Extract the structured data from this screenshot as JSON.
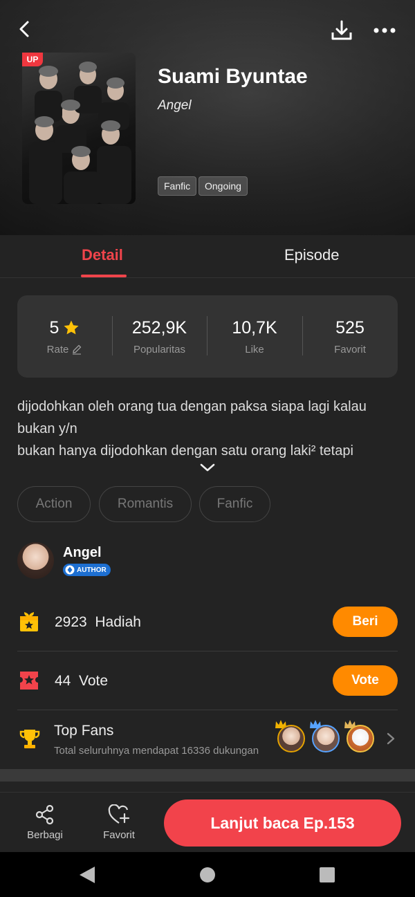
{
  "header": {
    "title": "Suami Byuntae",
    "author": "Angel",
    "up_badge": "UP",
    "chips": [
      "Fanfic",
      "Ongoing"
    ]
  },
  "tabs": [
    {
      "label": "Detail",
      "active": true
    },
    {
      "label": "Episode",
      "active": false
    }
  ],
  "stats": [
    {
      "value": "5",
      "label": "Rate"
    },
    {
      "value": "252,9K",
      "label": "Popularitas"
    },
    {
      "value": "10,7K",
      "label": "Like"
    },
    {
      "value": "525",
      "label": "Favorit"
    }
  ],
  "synopsis": [
    "dijodohkan oleh orang tua dengan paksa siapa lagi kalau",
    "bukan y/n",
    "bukan hanya dijodohkan dengan satu orang laki² tetapi"
  ],
  "genres": [
    "Action",
    "Romantis",
    "Fanfic"
  ],
  "author_section": {
    "name": "Angel",
    "badge": "AUTHOR"
  },
  "gift": {
    "count": "2923",
    "label": "Hadiah",
    "button": "Beri"
  },
  "vote": {
    "count": "44",
    "label": "Vote",
    "button": "Vote"
  },
  "top_fans": {
    "title": "Top Fans",
    "subtitle": "Total seluruhnya mendapat 16336 dukungan"
  },
  "bottom_bar": {
    "share_label": "Berbagi",
    "favorite_label": "Favorit",
    "read_button": "Lanjut baca Ep.153"
  },
  "colors": {
    "accent": "#f2434b",
    "orange": "#ff8a00",
    "star": "#ffc107",
    "background": "#232323"
  }
}
